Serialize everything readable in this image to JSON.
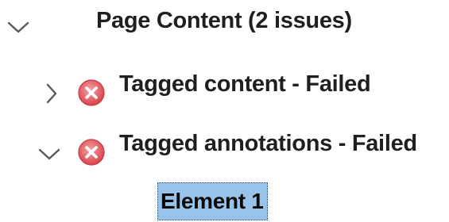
{
  "tree": {
    "root": {
      "label": "Page Content (2 issues)",
      "expanded": true,
      "toggle_icon": "chevron-down-icon"
    },
    "children": [
      {
        "label": "Tagged content - Failed",
        "expanded": false,
        "status": "failed",
        "toggle_icon": "chevron-right-icon",
        "status_icon": "error-icon"
      },
      {
        "label": "Tagged annotations - Failed",
        "expanded": true,
        "status": "failed",
        "toggle_icon": "chevron-down-icon",
        "status_icon": "error-icon",
        "children": [
          {
            "label": "Element 1",
            "selected": true
          }
        ]
      }
    ]
  },
  "colors": {
    "error_fill": "#e0555b",
    "error_fill_light": "#f4a3a6",
    "selection_background": "#99c3e9",
    "selection_border": "#2d4f73",
    "chevron": "#5a5a5a",
    "text": "#1f1f1f"
  }
}
